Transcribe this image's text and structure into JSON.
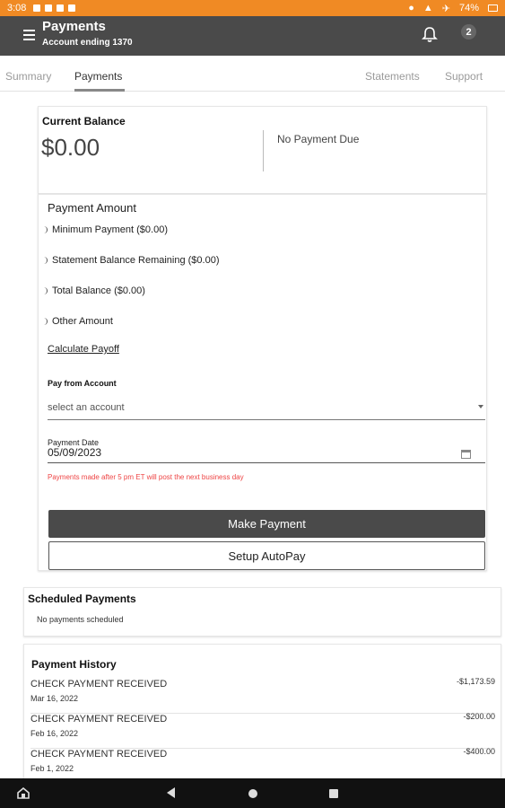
{
  "status_bar": {
    "time": "3:08",
    "battery": "74%"
  },
  "app_bar": {
    "title": "Payments",
    "subtitle": "Account ending 1370",
    "notification_count": "2"
  },
  "tabs": [
    {
      "label": "Summary",
      "active": false
    },
    {
      "label": "Payments",
      "active": true
    },
    {
      "label": "Statements",
      "active": false
    },
    {
      "label": "Support",
      "active": false
    }
  ],
  "balance": {
    "label": "Current Balance",
    "value": "$0.00",
    "due_text": "No Payment Due"
  },
  "payment_amount": {
    "title": "Payment Amount",
    "options": [
      "Minimum Payment ($0.00)",
      "Statement Balance Remaining ($0.00)",
      "Total Balance ($0.00)",
      "Other Amount"
    ],
    "payoff_link": "Calculate Payoff",
    "pay_from_label": "Pay from Account",
    "pay_from_placeholder": "select an account",
    "date_label": "Payment Date",
    "date_value": "05/09/2023",
    "warning": "Payments made after 5 pm ET will post the next business day",
    "make_payment_label": "Make Payment",
    "autopay_label": "Setup AutoPay"
  },
  "scheduled": {
    "title": "Scheduled Payments",
    "empty_text": "No payments scheduled"
  },
  "history": {
    "title": "Payment History",
    "rows": [
      {
        "desc": "CHECK PAYMENT RECEIVED",
        "date": "Mar 16, 2022",
        "amount": "-$1,173.59"
      },
      {
        "desc": "CHECK PAYMENT RECEIVED",
        "date": "Feb 16, 2022",
        "amount": "-$200.00"
      },
      {
        "desc": "CHECK PAYMENT RECEIVED",
        "date": "Feb 1, 2022",
        "amount": "-$400.00"
      }
    ]
  },
  "colors": {
    "status_bar": "#f08a24",
    "app_bar": "#4a4a4a",
    "warning": "#e44444",
    "button": "#4a4a4a"
  },
  "icons": [
    "menu-icon",
    "bell-icon",
    "calendar-icon",
    "home-icon",
    "back-icon",
    "circle-home-icon",
    "square-recents-icon"
  ]
}
